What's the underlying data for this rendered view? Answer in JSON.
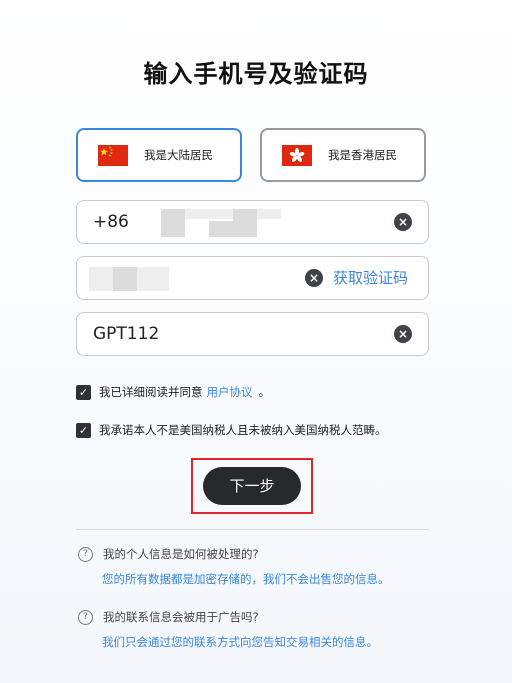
{
  "title": "输入手机号及验证码",
  "residence": {
    "mainland_label": "我是大陆居民",
    "hongkong_label": "我是香港居民"
  },
  "phone": {
    "prefix": "+86"
  },
  "code": {
    "get_code_label": "获取验证码"
  },
  "invite": {
    "value": "GPT112"
  },
  "agreements": {
    "terms_text": "我已详细阅读并同意",
    "terms_link": "用户协议",
    "terms_end": "。",
    "tax_text": "我承诺本人不是美国纳税人且未被纳入美国纳税人范畴。"
  },
  "next_label": "下一步",
  "faq": {
    "q1": "我的个人信息是如何被处理的?",
    "a1": "您的所有数据都是加密存储的，我们不会出售您的信息。",
    "q2": "我的联系信息会被用于广告吗?",
    "a2": "我们只会通过您的联系方式向您告知交易相关的信息。"
  },
  "icons": {
    "clear": "clear-icon",
    "check": "check-icon",
    "help": "help-icon",
    "cn_flag": "china-flag-icon",
    "hk_flag": "hongkong-flag-icon"
  },
  "colors": {
    "accent": "#3a86e0",
    "button": "#27292c",
    "highlight": "#e0262b",
    "flag_red": "#de2910"
  }
}
